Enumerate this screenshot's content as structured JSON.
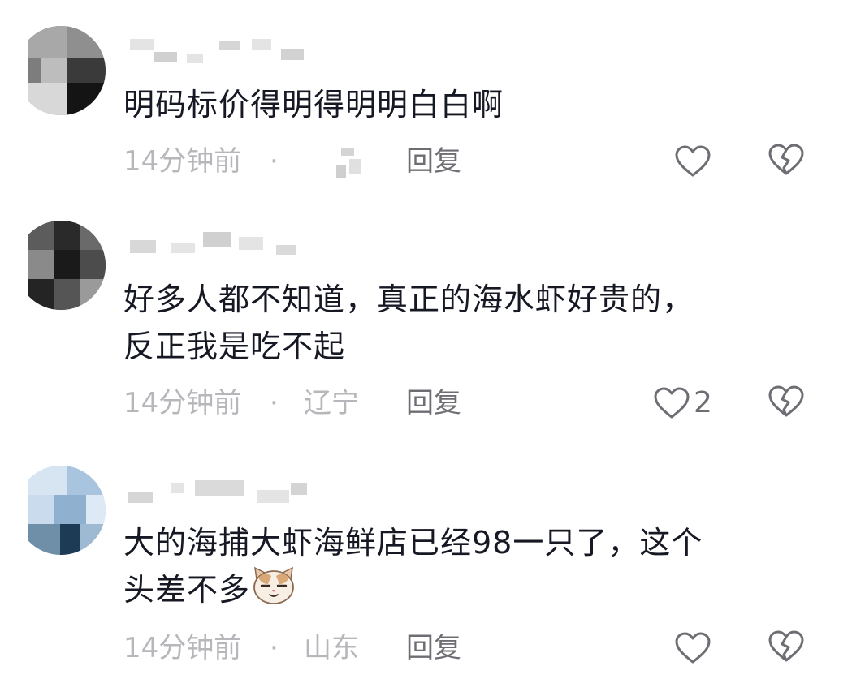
{
  "comments": [
    {
      "text": "明码标价得明得明明白白啊",
      "time": "14分钟前",
      "dot": "·",
      "location": "",
      "reply_label": "回复",
      "like_count": "",
      "avatar_icon": "blurred-avatar-icon",
      "like_icon": "heart-outline-icon",
      "dislike_icon": "broken-heart-icon"
    },
    {
      "text": "好多人都不知道，真正的海水虾好贵的，\n反正我是吃不起",
      "time": "14分钟前",
      "dot": "·",
      "location": "辽宁",
      "reply_label": "回复",
      "like_count": "2",
      "avatar_icon": "blurred-avatar-icon",
      "like_icon": "heart-outline-icon",
      "dislike_icon": "broken-heart-icon"
    },
    {
      "text": "大的海捕大虾海鲜店已经98一只了，这个\n头差不多",
      "time": "14分钟前",
      "dot": "·",
      "location": "山东",
      "reply_label": "回复",
      "like_count": "",
      "avatar_icon": "blurred-avatar-icon",
      "like_icon": "heart-outline-icon",
      "dislike_icon": "broken-heart-icon",
      "emoji_icon": "smug-cat-emoji-icon"
    }
  ],
  "colors": {
    "text": "#161823",
    "meta": "#b7b7bb",
    "reply": "#6d6d73",
    "icon": "#6d6d73"
  }
}
